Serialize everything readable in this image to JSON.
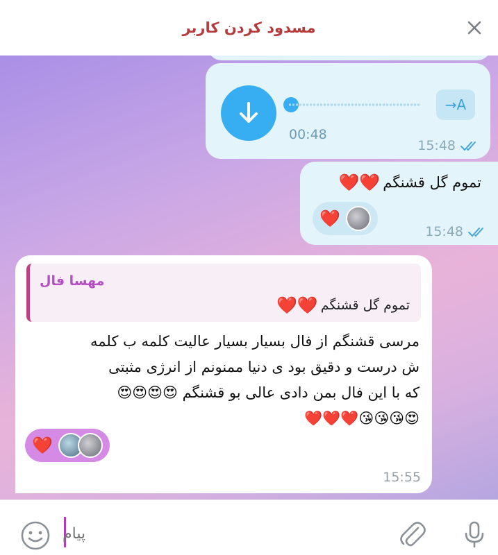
{
  "header": {
    "title": "مسدود کردن کاربر",
    "close_icon": "close-icon"
  },
  "messages": {
    "voice": {
      "duration": "00:48",
      "time": "15:48",
      "transcribe_label": "→A"
    },
    "outgoing_text": {
      "text": "تموم گل قشنگم",
      "emoji": "❤️❤️",
      "time": "15:48",
      "reaction_emoji": "❤️"
    },
    "incoming": {
      "reply_name": "مهسا فال",
      "reply_text": "تموم گل قشنگم",
      "reply_emoji": "❤️❤️",
      "line1": "مرسی قشنگم  از فال بسیار بسیار عالیت  کلمه ب کلمه",
      "line2": "ش درست و دقیق بود  ی دنیا ممنونم از انرژی مثبتی",
      "line3": "که با این فال بمن دادی عالی بو قشنگم 😍😍😍😍",
      "line4": "😍😘😘😘❤️❤️❤️",
      "time": "15:55",
      "reaction_emoji": "❤️"
    }
  },
  "input": {
    "placeholder": "پیام"
  },
  "colors": {
    "accent": "#38aef2",
    "header_title": "#b53c3c",
    "reply_name": "#b44fc2",
    "heart": "#e41b2f"
  }
}
